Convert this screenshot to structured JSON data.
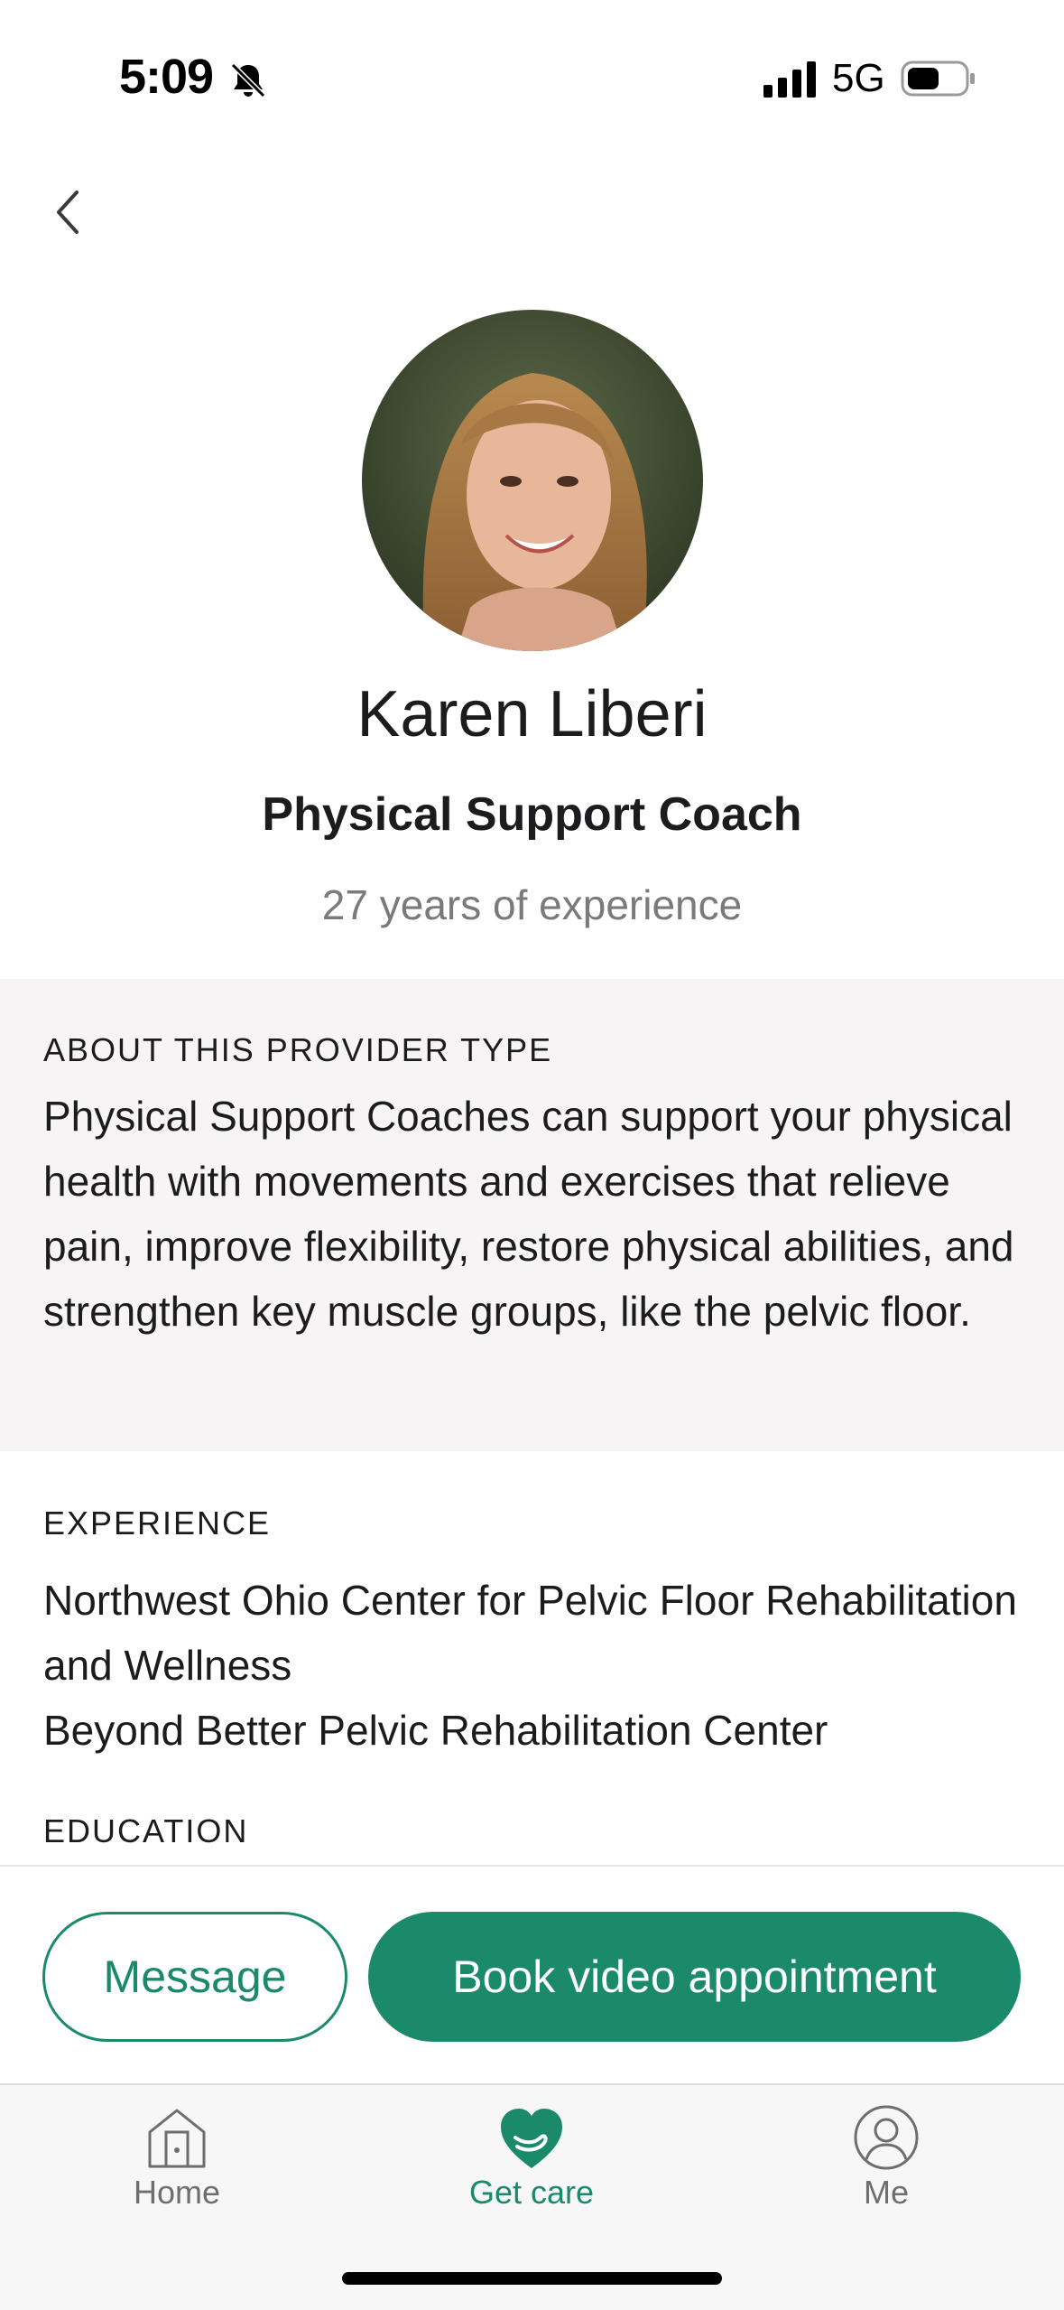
{
  "status_bar": {
    "time": "5:09",
    "network": "5G"
  },
  "provider": {
    "name": "Karen Liberi",
    "role": "Physical Support Coach",
    "experience_years": "27 years of experience"
  },
  "about": {
    "heading": "ABOUT THIS PROVIDER TYPE",
    "body": "Physical Support Coaches can support your physical health with movements and exercises that relieve pain, improve flexibility, restore physical abilities, and strengthen key muscle groups, like the pelvic floor."
  },
  "experience": {
    "heading": "EXPERIENCE",
    "items": [
      "Northwest Ohio Center for Pelvic Floor Rehabilitation and Wellness",
      "Beyond Better Pelvic Rehabilitation Center"
    ]
  },
  "education": {
    "heading": "EDUCATION"
  },
  "actions": {
    "message_label": "Message",
    "book_label": "Book video appointment"
  },
  "tabs": [
    {
      "label": "Home",
      "icon": "home-icon"
    },
    {
      "label": "Get care",
      "icon": "heart-hand-icon",
      "active": true
    },
    {
      "label": "Me",
      "icon": "person-icon"
    }
  ],
  "colors": {
    "accent": "#1b8a6b",
    "section_bg": "#f6f4f4",
    "muted_text": "#7a7a7c"
  }
}
